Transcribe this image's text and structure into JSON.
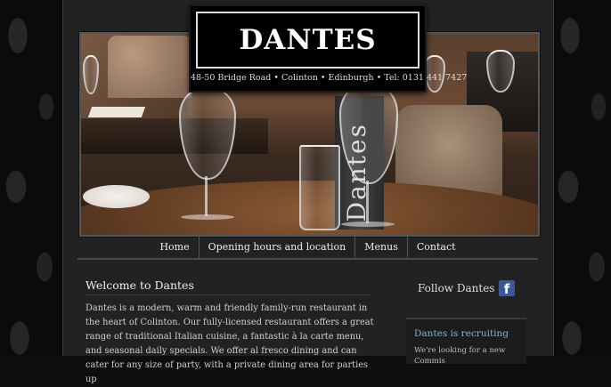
{
  "logo": {
    "name": "DANTES",
    "address": "48-50 Bridge Road • Colinton • Edinburgh • Tel: 0131 441 7427"
  },
  "hero": {
    "menu_card_text": "Dantes"
  },
  "nav": {
    "items": [
      {
        "label": "Home"
      },
      {
        "label": "Opening hours and location"
      },
      {
        "label": "Menus"
      },
      {
        "label": "Contact"
      }
    ]
  },
  "main": {
    "heading": "Welcome to Dantes",
    "body": "Dantes is a modern, warm and friendly family-run restaurant in the heart of Colinton. Our fully-licensed restaurant offers a great range of traditional Italian cuisine, a fantastic à la carte menu, and seasonal daily specials. We offer al fresco dining and can cater for any size of party, with a private dining area for parties up"
  },
  "sidebar": {
    "follow_label": "Follow Dantes on",
    "facebook_icon": "facebook-icon",
    "recruit_title": "Dantes is recruiting",
    "recruit_text": "We're looking for a new Commis"
  },
  "colors": {
    "page_bg": "#222222",
    "accent_link": "#7db3d8",
    "facebook": "#3b5998"
  }
}
